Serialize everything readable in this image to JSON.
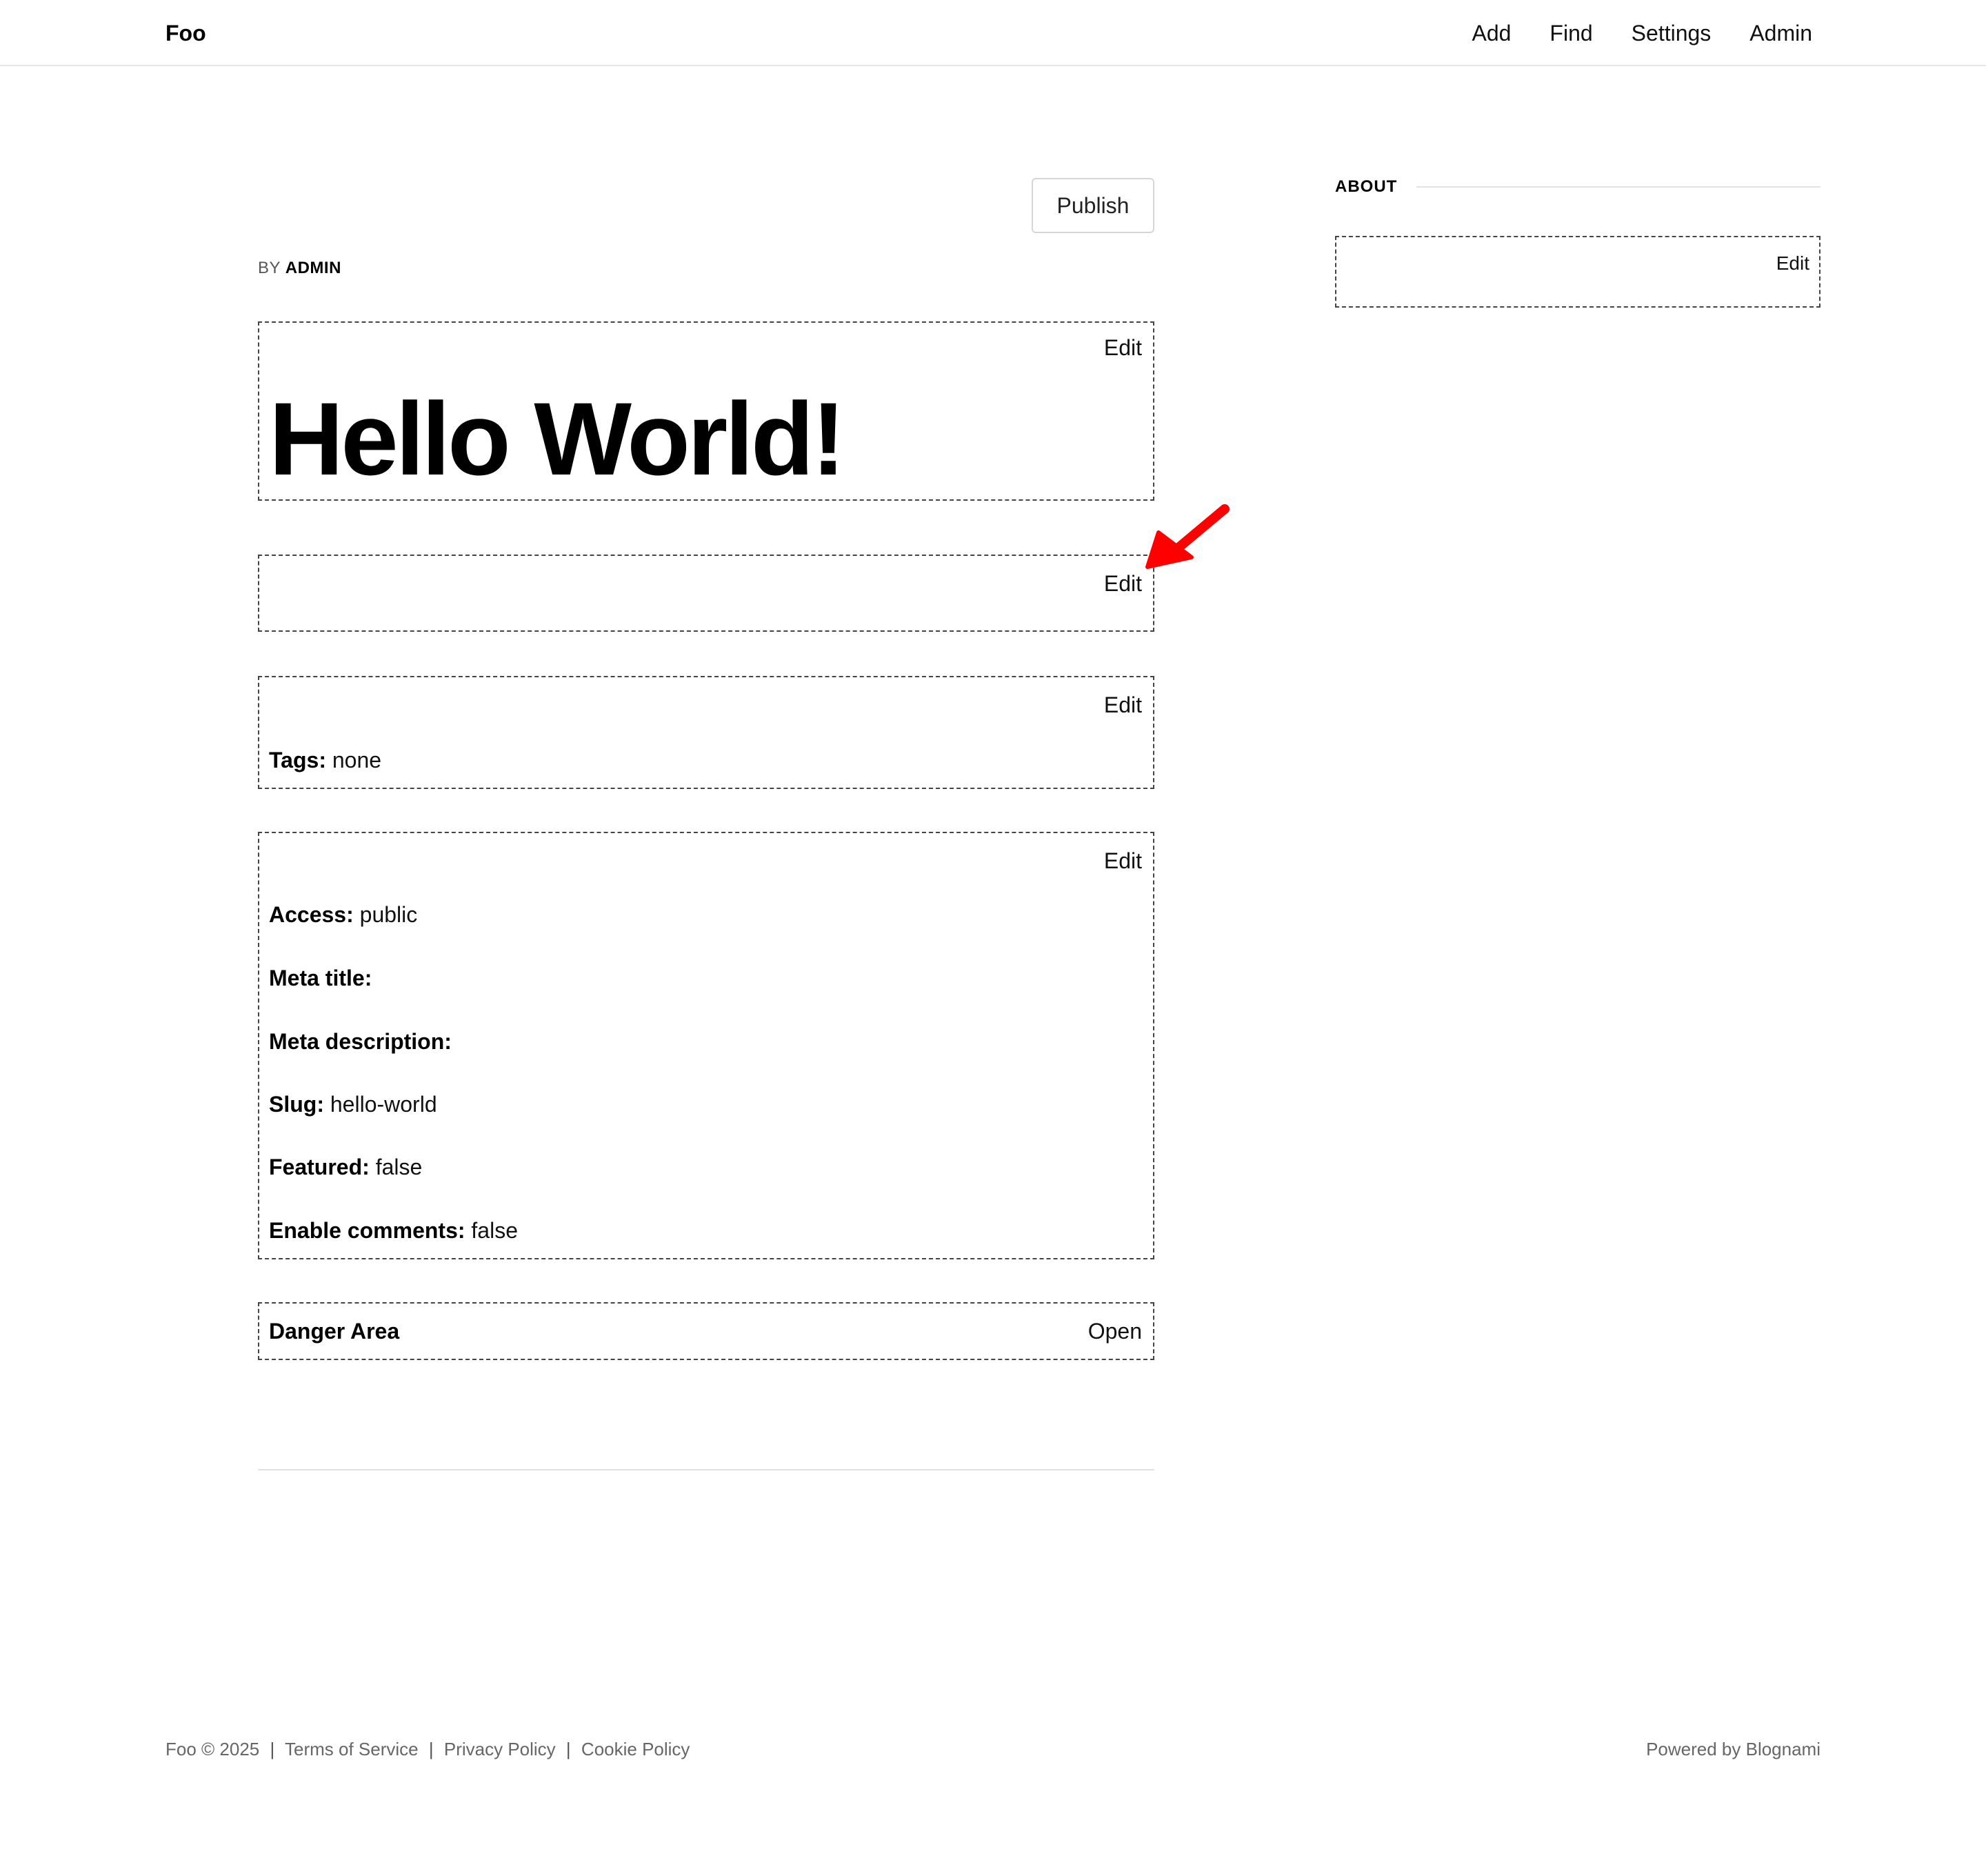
{
  "header": {
    "brand": "Foo",
    "nav": [
      "Add",
      "Find",
      "Settings",
      "Admin"
    ]
  },
  "post": {
    "publish_label": "Publish",
    "byline_prefix": "BY",
    "author": "ADMIN",
    "title": "Hello World!",
    "edit_label": "Edit",
    "tags": {
      "label": "Tags:",
      "value": "none"
    },
    "meta": [
      {
        "label": "Access:",
        "value": "public"
      },
      {
        "label": "Meta title:",
        "value": ""
      },
      {
        "label": "Meta description:",
        "value": ""
      },
      {
        "label": "Slug:",
        "value": "hello-world"
      },
      {
        "label": "Featured:",
        "value": "false"
      },
      {
        "label": "Enable comments:",
        "value": "false"
      }
    ],
    "danger": {
      "title": "Danger Area",
      "action": "Open"
    }
  },
  "sidebar": {
    "about_heading": "ABOUT",
    "edit_label": "Edit"
  },
  "footer": {
    "copyright": "Foo © 2025",
    "links": [
      "Terms of Service",
      "Privacy Policy",
      "Cookie Policy"
    ],
    "separator": "|",
    "powered": "Powered by Blognami"
  },
  "annotation": {
    "arrow_color": "#ff0000",
    "points_to": "content-edit-link"
  }
}
